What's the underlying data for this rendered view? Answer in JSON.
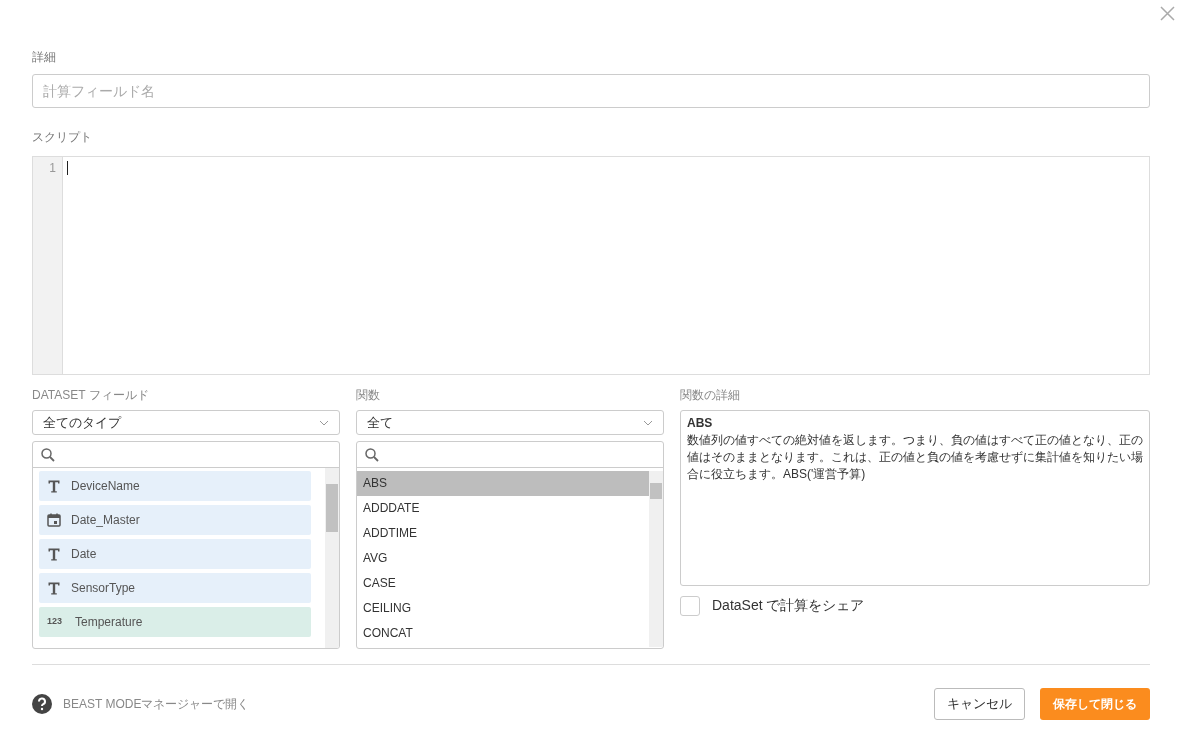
{
  "details": {
    "label": "詳細",
    "name_field": {
      "placeholder": "計算フィールド名"
    }
  },
  "script": {
    "label": "スクリプト",
    "line_numbers": [
      "1"
    ]
  },
  "dataset_fields": {
    "label": "DATASET フィールド",
    "type_select": "全てのタイプ",
    "items": [
      {
        "kind": "text",
        "name": "DeviceName"
      },
      {
        "kind": "date",
        "name": "Date_Master"
      },
      {
        "kind": "text",
        "name": "Date"
      },
      {
        "kind": "text",
        "name": "SensorType"
      },
      {
        "kind": "number",
        "name": "Temperature",
        "badge": "123"
      }
    ]
  },
  "functions": {
    "label": "関数",
    "category_select": "全て",
    "items": [
      {
        "name": "ABS",
        "selected": true
      },
      {
        "name": "ADDDATE",
        "selected": false
      },
      {
        "name": "ADDTIME",
        "selected": false
      },
      {
        "name": "AVG",
        "selected": false
      },
      {
        "name": "CASE",
        "selected": false
      },
      {
        "name": "CEILING",
        "selected": false
      },
      {
        "name": "CONCAT",
        "selected": false
      }
    ]
  },
  "function_details": {
    "label": "関数の詳細",
    "title": "ABS",
    "description": "数値列の値すべての絶対値を返します。つまり、負の値はすべて正の値となり、正の値はそのままとなります。これは、正の値と負の値を考慮せずに集計値を知りたい場合に役立ちます。ABS('運営予算)"
  },
  "share": {
    "label": "DataSet で計算をシェア",
    "checked": false
  },
  "footer": {
    "help_link": "BEAST MODEマネージャーで開く",
    "cancel": "キャンセル",
    "save": "保存して閉じる"
  }
}
